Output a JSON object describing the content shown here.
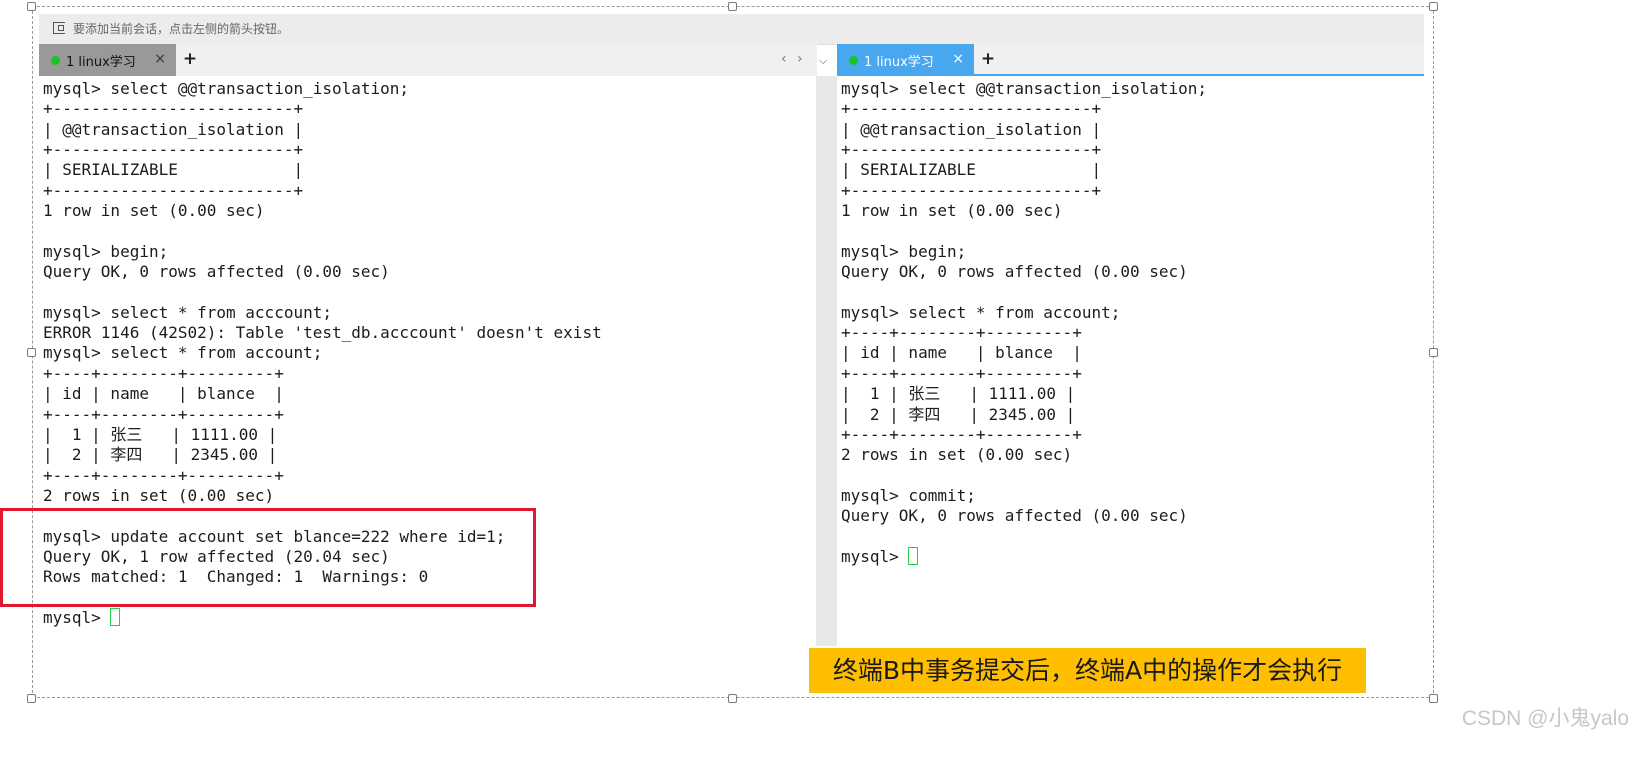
{
  "hint_bar": {
    "text": "要添加当前会话，点击左侧的箭头按钮。",
    "icon": "add-session-icon"
  },
  "left_pane": {
    "tab_label": "1 linux学习",
    "tab_close": "×",
    "add_tab": "+",
    "nav_prev": "‹",
    "nav_next": "›",
    "nav_more": "⌵",
    "lines": [
      "mysql> select @@transaction_isolation;",
      "+-------------------------+",
      "| @@transaction_isolation |",
      "+-------------------------+",
      "| SERIALIZABLE            |",
      "+-------------------------+",
      "1 row in set (0.00 sec)",
      "",
      "mysql> begin;",
      "Query OK, 0 rows affected (0.00 sec)",
      "",
      "mysql> select * from acccount;",
      "ERROR 1146 (42S02): Table 'test_db.acccount' doesn't exist",
      "mysql> select * from account;",
      "+----+--------+---------+",
      "| id | name   | blance  |",
      "+----+--------+---------+",
      "|  1 | 张三   | 1111.00 |",
      "|  2 | 李四   | 2345.00 |",
      "+----+--------+---------+",
      "2 rows in set (0.00 sec)",
      "",
      "mysql> update account set blance=222 where id=1;",
      "Query OK, 1 row affected (20.04 sec)",
      "Rows matched: 1  Changed: 1  Warnings: 0",
      ""
    ],
    "prompt": "mysql> "
  },
  "right_pane": {
    "tab_label": "1 linux学习",
    "tab_close": "×",
    "add_tab": "+",
    "lines": [
      "mysql> select @@transaction_isolation;",
      "+-------------------------+",
      "| @@transaction_isolation |",
      "+-------------------------+",
      "| SERIALIZABLE            |",
      "+-------------------------+",
      "1 row in set (0.00 sec)",
      "",
      "mysql> begin;",
      "Query OK, 0 rows affected (0.00 sec)",
      "",
      "mysql> select * from account;",
      "+----+--------+---------+",
      "| id | name   | blance  |",
      "+----+--------+---------+",
      "|  1 | 张三   | 1111.00 |",
      "|  2 | 李四   | 2345.00 |",
      "+----+--------+---------+",
      "2 rows in set (0.00 sec)",
      "",
      "mysql> commit;",
      "Query OK, 0 rows affected (0.00 sec)",
      ""
    ],
    "prompt": "mysql> "
  },
  "annotation": "终端B中事务提交后，终端A中的操作才会执行",
  "watermark": "CSDN @小鬼yalo",
  "colors": {
    "highlight_box": "#e0182d",
    "annotation_bg": "#ffbf00",
    "active_tab": "#49a7ef",
    "inactive_tab": "#999999",
    "cursor": "#23d04a",
    "status_dot": "#19c42b"
  }
}
